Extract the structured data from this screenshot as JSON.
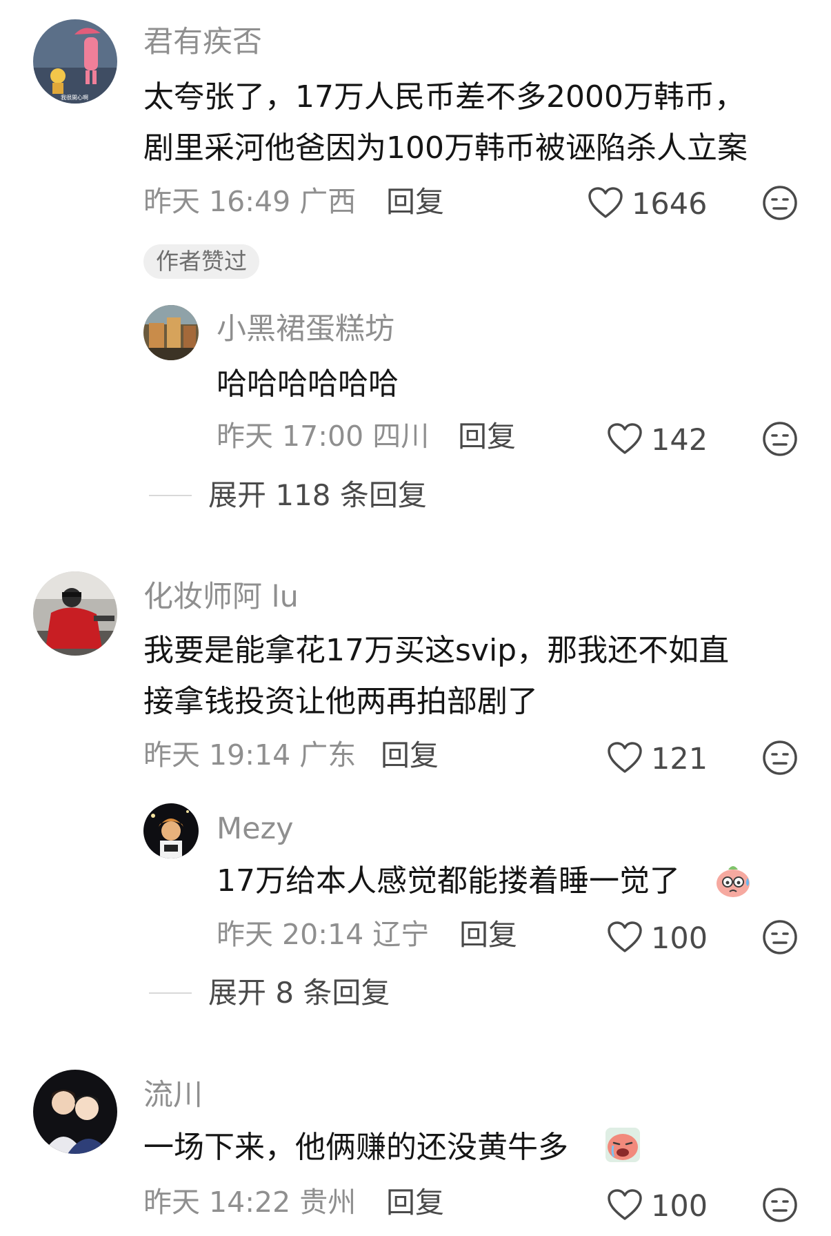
{
  "comments": [
    {
      "username": "君有疾否",
      "text_lines": [
        "太夸张了，17万人民币差不多2000万韩币，",
        "剧里采河他爸因为100万韩币被诬陷杀人立案"
      ],
      "time": "昨天 16:49",
      "location": "广西",
      "reply_label": "回复",
      "likes": "1646",
      "badge": "作者赞过",
      "replies": [
        {
          "username": "小黑裙蛋糕坊",
          "text": "哈哈哈哈哈哈",
          "time": "昨天 17:00",
          "location": "四川",
          "reply_label": "回复",
          "likes": "142"
        }
      ],
      "expand_label": "展开 118 条回复"
    },
    {
      "username": "化妆师阿 lu",
      "text_lines": [
        "我要是能拿花17万买这svip，那我还不如直",
        "接拿钱投资让他两再拍部剧了"
      ],
      "time": "昨天 19:14",
      "location": "广东",
      "reply_label": "回复",
      "likes": "121",
      "replies": [
        {
          "username": "Mezy",
          "text": "17万给本人感觉都能搂着睡一觉了",
          "emoji": "sweat-face-emoji",
          "time": "昨天 20:14",
          "location": "辽宁",
          "reply_label": "回复",
          "likes": "100"
        }
      ],
      "expand_label": "展开 8 条回复"
    },
    {
      "username": "流川",
      "text_lines": [
        "一场下来，他俩赚的还没黄牛多"
      ],
      "emoji": "crying-face-emoji",
      "time": "昨天 14:22",
      "location": "贵州",
      "reply_label": "回复",
      "likes": "100"
    }
  ],
  "icons": {
    "like": "heart-outline-icon",
    "dislike": "meh-face-icon"
  },
  "colors": {
    "username": "#8f8f8f",
    "text": "#151515",
    "meta": "#8f8f8f",
    "action": "#4a4a4a",
    "badge_bg": "#efefef"
  }
}
